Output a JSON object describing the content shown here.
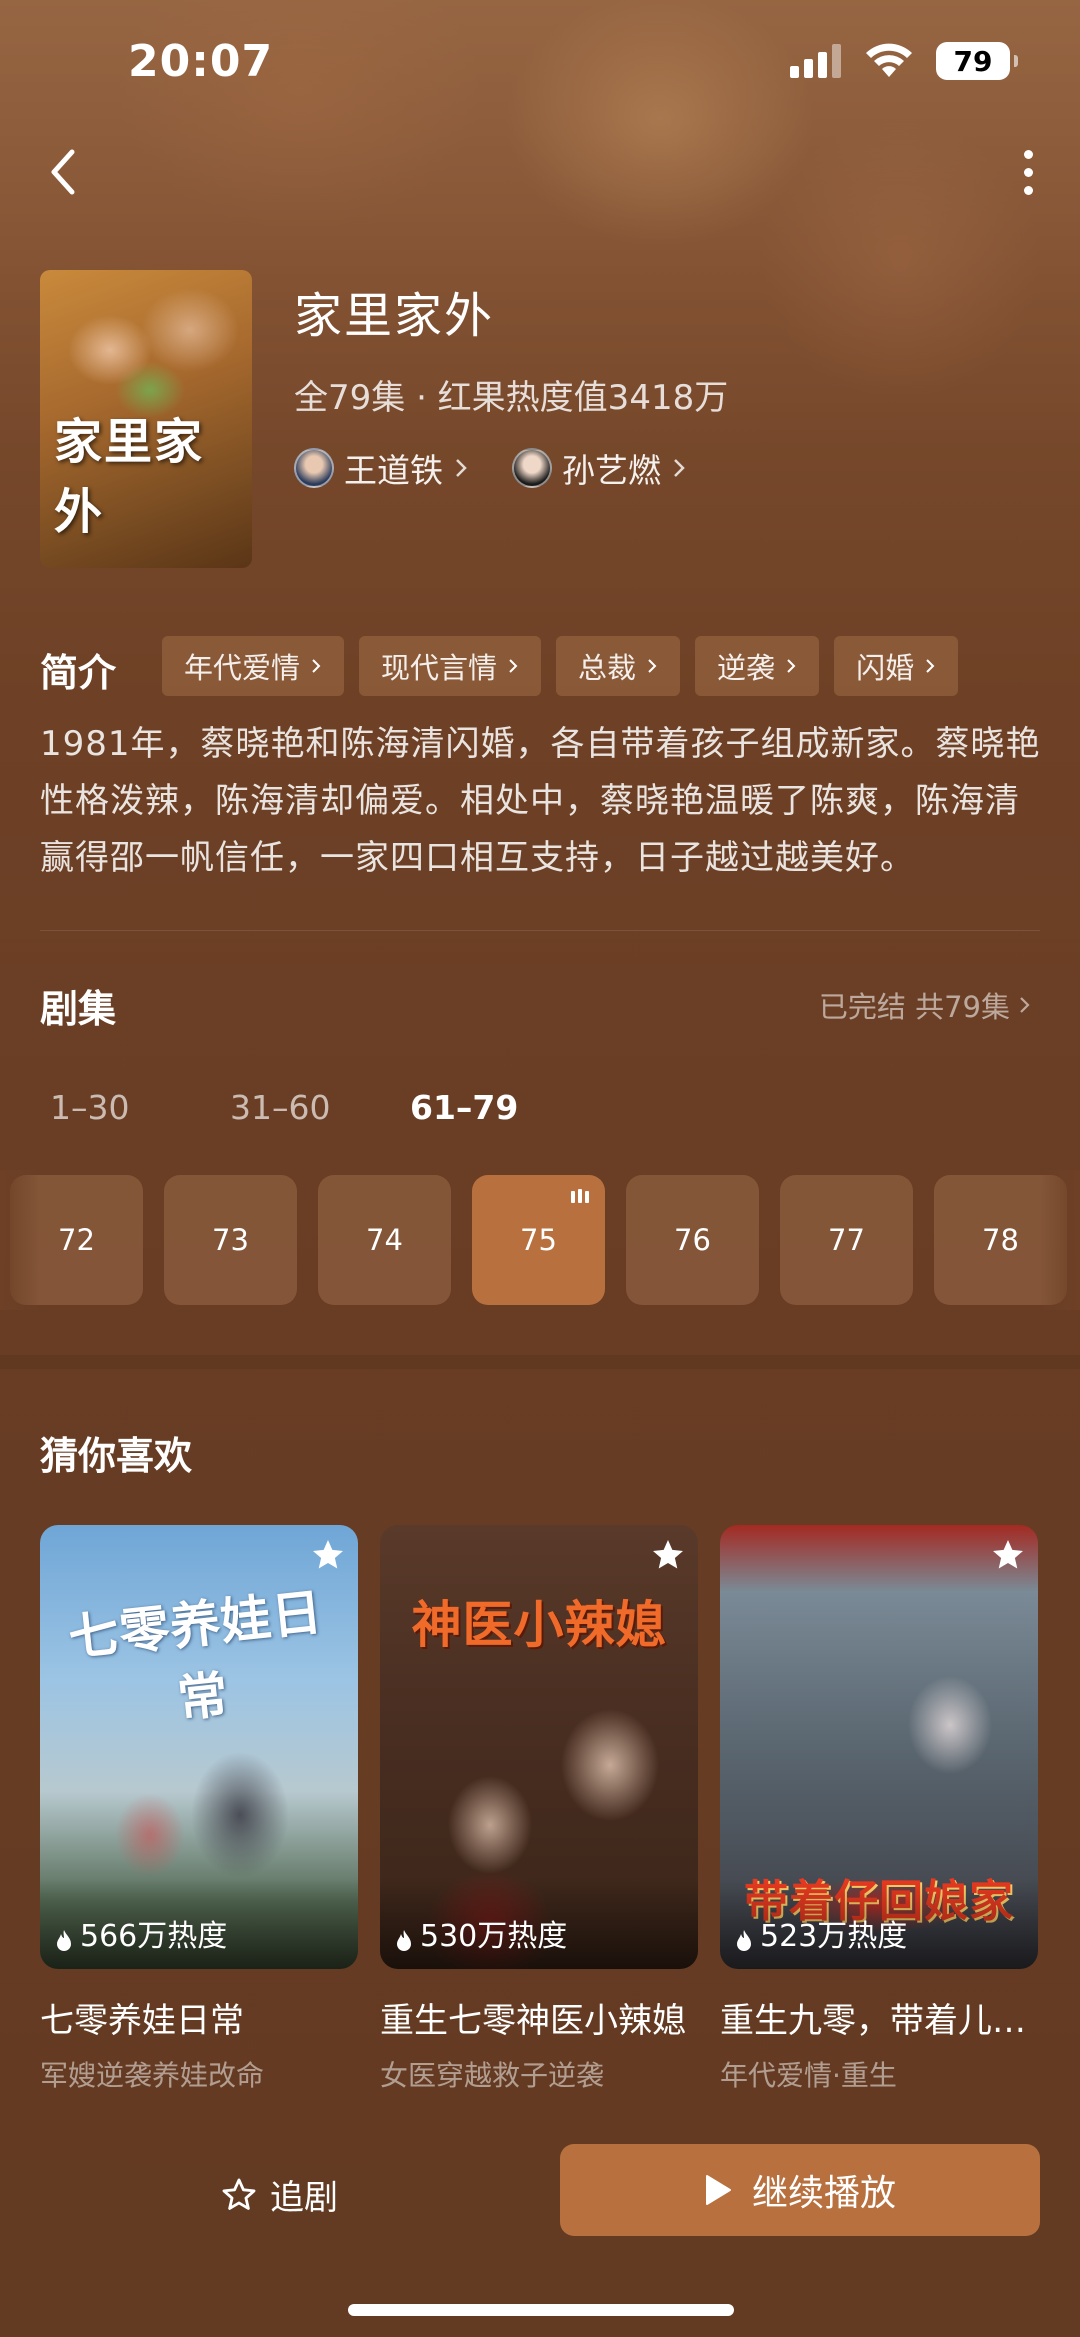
{
  "status": {
    "time": "20:07",
    "battery": "79"
  },
  "show": {
    "title": "家里家外",
    "poster_title": "家里家外",
    "meta": "全79集 · 红果热度值3418万",
    "cast": [
      {
        "name": "王道铁"
      },
      {
        "name": "孙艺燃"
      }
    ]
  },
  "intro": {
    "label": "简介",
    "tags": [
      "年代爱情",
      "现代言情",
      "总裁",
      "逆袭",
      "闪婚"
    ],
    "synopsis": "1981年，蔡晓艳和陈海清闪婚，各自带着孩子组成新家。蔡晓艳性格泼辣，陈海清却偏爱。相处中，蔡晓艳温暖了陈爽，陈海清赢得邵一帆信任，一家四口相互支持，日子越过越美好。"
  },
  "episodes": {
    "title": "剧集",
    "status": "已完结 共79集",
    "ranges": [
      "1–30",
      "31–60",
      "61–79"
    ],
    "active_range": "61–79",
    "items": [
      "72",
      "73",
      "74",
      "75",
      "76",
      "77",
      "78"
    ],
    "current": "75"
  },
  "recommend": {
    "title": "猜你喜欢",
    "items": [
      {
        "name": "七零养娃日常",
        "sub": "军嫂逆袭养娃改命",
        "heat": "566万热度",
        "cover_title": "七零养娃日常"
      },
      {
        "name": "重生七零神医小辣媳",
        "sub": "女医穿越救子逆袭",
        "heat": "530万热度",
        "cover_title": "神医小辣媳"
      },
      {
        "name": "重生九零，带着儿…",
        "sub": "年代爱情·重生",
        "heat": "523万热度",
        "cover_title": "带着仔回娘家"
      }
    ]
  },
  "actions": {
    "follow_label": "追剧",
    "play_label": "继续播放"
  },
  "colors": {
    "accent": "#b8703f",
    "background": "#6e4126"
  }
}
